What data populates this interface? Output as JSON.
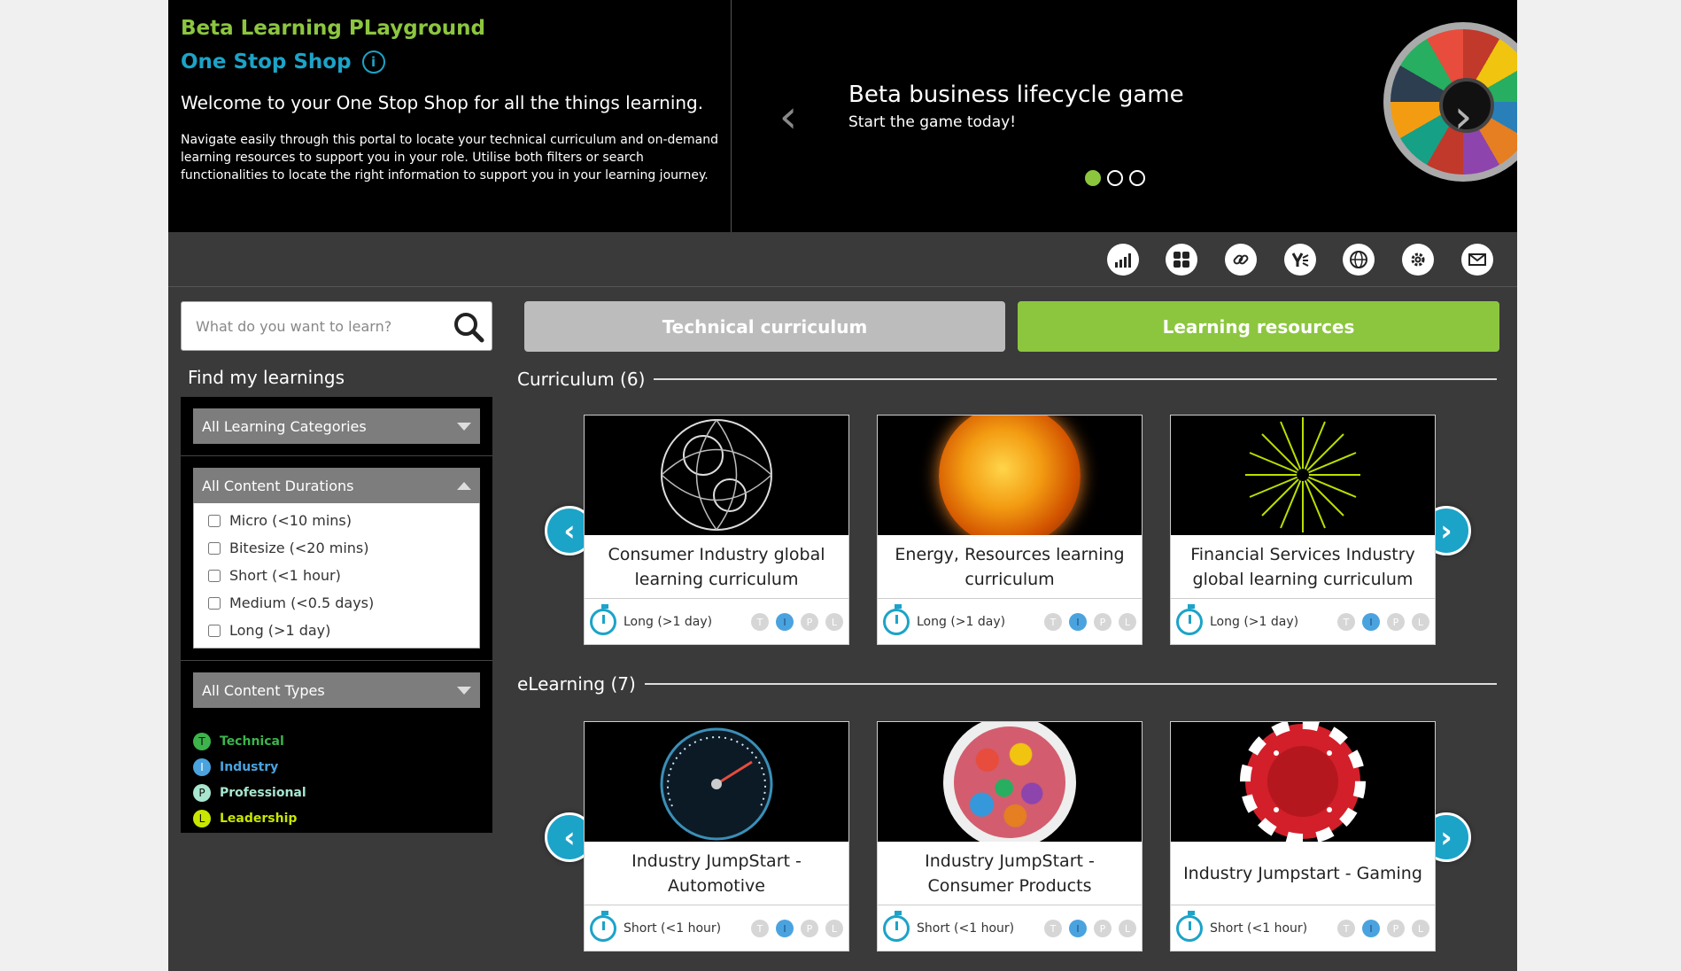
{
  "hero": {
    "title": "Beta Learning PLayground",
    "subtitle": "One Stop Shop",
    "info_icon": "i",
    "welcome": "Welcome to your One Stop Shop for all the things learning.",
    "blurb": "Navigate easily through this portal to locate your technical curriculum and on-demand learning resources to support you in your role. Utilise both filters or search functionalities to locate the right information to support you in your learning journey.",
    "carousel": {
      "slide_title": "Beta business lifecycle game",
      "slide_subtitle": "Start the game today!",
      "prev_glyph": "‹",
      "next_glyph": "›",
      "active_dot": 0,
      "dots": 3
    }
  },
  "toolbar": {
    "icons": [
      "chart-icon",
      "grid-icon",
      "link-icon",
      "yammer-icon",
      "globe-icon",
      "gear-icon",
      "mail-icon"
    ]
  },
  "search": {
    "placeholder": "What do you want to learn?"
  },
  "sidebar": {
    "title": "Find my learnings",
    "categories_label": "All Learning Categories",
    "durations_label": "All Content Durations",
    "durations": [
      "Micro (<10 mins)",
      "Bitesize (<20 mins)",
      "Short (<1 hour)",
      "Medium (<0.5 days)",
      "Long (>1 day)"
    ],
    "types_label": "All Content Types",
    "legend": [
      {
        "letter": "T",
        "label": "Technical",
        "color": "#3cb44b"
      },
      {
        "letter": "I",
        "label": "Industry",
        "color": "#4aa3df"
      },
      {
        "letter": "P",
        "label": "Professional",
        "color": "#a8e6cf"
      },
      {
        "letter": "L",
        "label": "Leadership",
        "color": "#c8e600"
      }
    ]
  },
  "tabs": {
    "technical": "Technical curriculum",
    "resources": "Learning resources"
  },
  "sections": {
    "curriculum": {
      "heading": "Curriculum (6)",
      "cards": [
        {
          "title": "Consumer Industry global learning curriculum",
          "duration": "Long (>1 day)"
        },
        {
          "title": "Energy, Resources learning curriculum",
          "duration": "Long (>1 day)"
        },
        {
          "title": "Financial Services Industry global learning curriculum",
          "duration": "Long (>1 day)"
        }
      ]
    },
    "elearning": {
      "heading": "eLearning (7)",
      "cards": [
        {
          "title": "Industry JumpStart - Automotive",
          "duration": "Short (<1 hour)"
        },
        {
          "title": "Industry JumpStart - Consumer Products",
          "duration": "Short (<1 hour)"
        },
        {
          "title": "Industry Jumpstart - Gaming",
          "duration": "Short (<1 hour)"
        }
      ]
    }
  },
  "badge_letters": [
    "T",
    "I",
    "P",
    "L"
  ],
  "colors": {
    "accent_green": "#8cc63f",
    "accent_teal": "#1ca3c8",
    "panel_bg": "#3a3a3a"
  }
}
